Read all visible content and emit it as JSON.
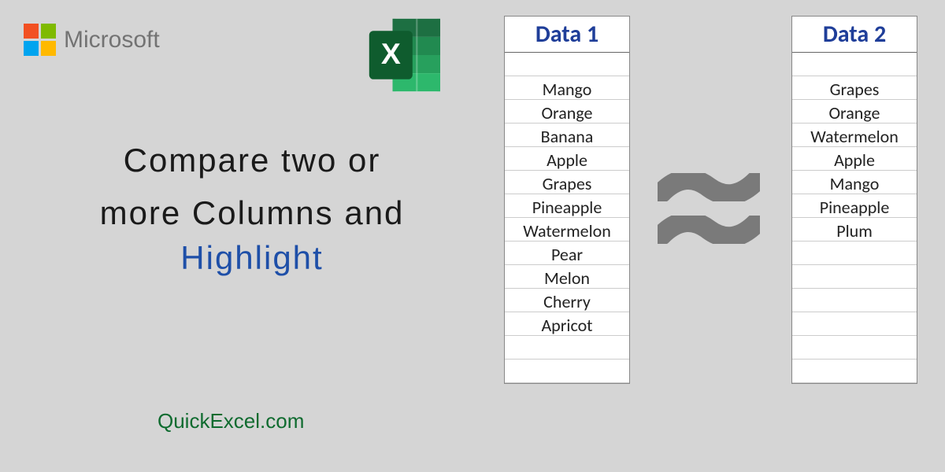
{
  "logo": {
    "text": "Microsoft"
  },
  "title": {
    "line1": "Compare two or",
    "line2": "more Columns and",
    "highlight": "Highlight"
  },
  "website": "QuickExcel.com",
  "table1": {
    "header": "Data 1",
    "rows": [
      "Mango",
      "Orange",
      "Banana",
      "Apple",
      "Grapes",
      "Pineapple",
      "Watermelon",
      "Pear",
      "Melon",
      "Cherry",
      "Apricot",
      "",
      ""
    ]
  },
  "table2": {
    "header": "Data 2",
    "rows": [
      "Grapes",
      "Orange",
      "Watermelon",
      "Apple",
      "Mango",
      "Pineapple",
      "Plum",
      "",
      "",
      "",
      "",
      "",
      ""
    ]
  },
  "chart_data": {
    "type": "table",
    "title": "Compare two or more Columns and Highlight",
    "series": [
      {
        "name": "Data 1",
        "values": [
          "Mango",
          "Orange",
          "Banana",
          "Apple",
          "Grapes",
          "Pineapple",
          "Watermelon",
          "Pear",
          "Melon",
          "Cherry",
          "Apricot"
        ]
      },
      {
        "name": "Data 2",
        "values": [
          "Grapes",
          "Orange",
          "Watermelon",
          "Apple",
          "Mango",
          "Pineapple",
          "Plum"
        ]
      }
    ]
  }
}
